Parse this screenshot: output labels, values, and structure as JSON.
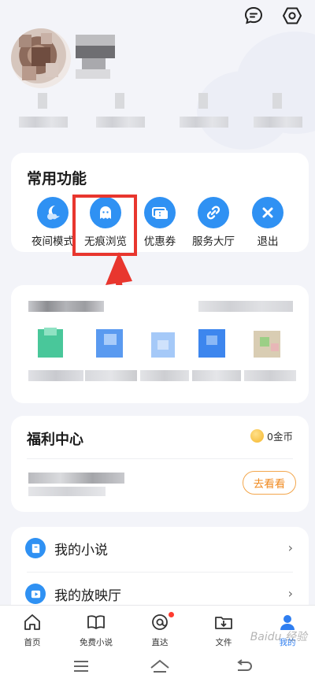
{
  "header": {
    "icons": [
      "message-icon",
      "settings-gear-icon"
    ]
  },
  "common_functions": {
    "title": "常用功能",
    "items": [
      {
        "label": "夜间模式",
        "icon": "night-mode-icon"
      },
      {
        "label": "无痕浏览",
        "icon": "incognito-ghost-icon"
      },
      {
        "label": "优惠券",
        "icon": "coupon-icon"
      },
      {
        "label": "服务大厅",
        "icon": "service-link-icon"
      },
      {
        "label": "退出",
        "icon": "exit-x-icon"
      }
    ]
  },
  "welfare": {
    "title": "福利中心",
    "coins": "0金币",
    "action": "去看看"
  },
  "list": [
    {
      "label": "我的小说",
      "icon": "book-icon",
      "chevron": "›"
    },
    {
      "label": "我的放映厅",
      "icon": "play-icon",
      "chevron": "›"
    }
  ],
  "bottom_nav": {
    "items": [
      {
        "label": "首页",
        "icon": "home-icon",
        "active": false
      },
      {
        "label": "免费小说",
        "icon": "open-book-icon",
        "active": false
      },
      {
        "label": "直达",
        "icon": "direct-at-icon",
        "active": false,
        "badge": true
      },
      {
        "label": "文件",
        "icon": "folder-download-icon",
        "active": false
      },
      {
        "label": "我的",
        "icon": "person-icon",
        "active": true
      }
    ]
  },
  "colors": {
    "accent": "#2f91f3",
    "highlight": "#e8362e",
    "orange": "#f08a1f"
  },
  "watermark": "Baidu 经验"
}
